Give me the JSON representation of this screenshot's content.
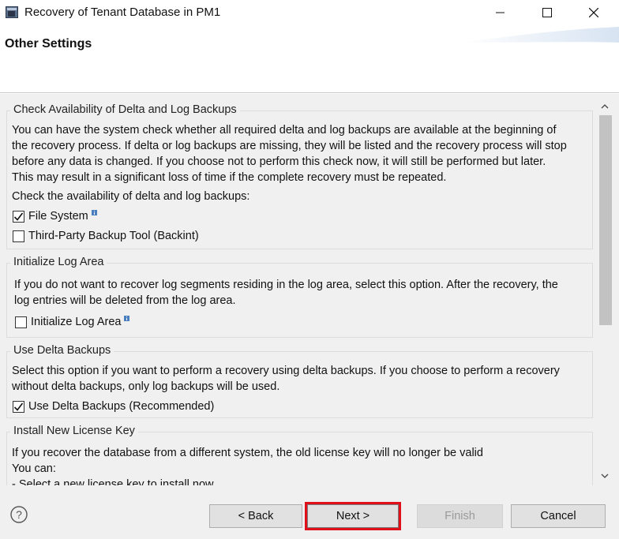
{
  "window": {
    "title": "Recovery of Tenant Database in PM1",
    "icon": "app-window-icon"
  },
  "header": {
    "title": "Other Settings"
  },
  "sections": {
    "check_availability": {
      "title": "Check Availability of Delta and Log Backups",
      "description_lines": [
        "You can have the system check whether all required delta and log backups are available at the beginning of",
        "the recovery process. If delta or log backups are missing, they will be listed and the recovery process will stop",
        "before any data is changed. If you choose not to perform this check now, it will still be performed but later.",
        "This may result in a significant loss of time if the complete recovery must be repeated."
      ],
      "prompt": "Check the availability of delta and log backups:",
      "options": [
        {
          "label": "File System",
          "checked": true,
          "info_icon": true
        },
        {
          "label": "Third-Party Backup Tool (Backint)",
          "checked": false,
          "info_icon": false
        }
      ]
    },
    "initialize_log_area": {
      "title": "Initialize Log Area",
      "description_lines": [
        "If you do not want to recover log segments residing in the log area, select this option. After the recovery, the",
        "log entries will be deleted from the log area."
      ],
      "option": {
        "label": "Initialize Log Area",
        "checked": false,
        "info_icon": true
      }
    },
    "use_delta_backups": {
      "title": "Use Delta Backups",
      "description_lines": [
        "Select this option if you want to perform a recovery using delta backups. If you choose to perform a recovery",
        "without delta backups, only log backups will be used."
      ],
      "option": {
        "label": "Use Delta Backups (Recommended)",
        "checked": true
      }
    },
    "install_license_key": {
      "title": "Install New License Key",
      "description_lines": [
        "If you recover the database from a different system, the old license key will no longer be valid",
        "You can:",
        "- Select a new license key to install now"
      ]
    }
  },
  "footer": {
    "back_label": "< Back",
    "next_label": "Next >",
    "finish_label": "Finish",
    "cancel_label": "Cancel",
    "finish_enabled": false,
    "highlight_color": "#e0101a"
  },
  "colors": {
    "content_bg": "#f0f0f0",
    "button_bg": "#e1e1e1"
  }
}
